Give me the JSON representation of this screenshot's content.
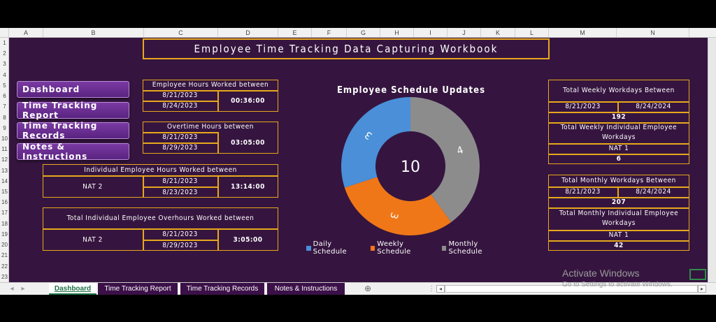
{
  "sheet": {
    "columns": [
      "A",
      "B",
      "C",
      "D",
      "E",
      "F",
      "G",
      "H",
      "I",
      "J",
      "K",
      "L",
      "M",
      "N"
    ],
    "rows": [
      "1",
      "2",
      "3",
      "4",
      "5",
      "6",
      "7",
      "8",
      "9",
      "10",
      "11",
      "12",
      "13",
      "14",
      "15",
      "16",
      "17",
      "18",
      "19",
      "20",
      "21",
      "22",
      "23"
    ]
  },
  "title": "Employee Time Tracking Data Capturing Workbook",
  "nav": {
    "dashboard": "Dashboard",
    "time_tracking_report": "Time Tracking Report",
    "time_tracking_records": "Time Tracking Records",
    "notes": "Notes & Instructions"
  },
  "box1": {
    "header": "Employee Hours Worked between",
    "start": "8/21/2023",
    "end": "8/24/2023",
    "value": "00:36:00"
  },
  "box2": {
    "header": "Overtime Hours between",
    "start": "8/21/2023",
    "end": "8/29/2023",
    "value": "03:05:00"
  },
  "box3": {
    "header": "Individual Employee Hours Worked between",
    "employee": "NAT 2",
    "start": "8/21/2023",
    "end": "8/23/2023",
    "value": "13:14:00"
  },
  "box4": {
    "header": "Total Individual Employee Overhours Worked between",
    "employee": "NAT 2",
    "start": "8/21/2023",
    "end": "8/29/2023",
    "value": "3:05:00"
  },
  "weekly": {
    "header": "Total Weekly Workdays Between",
    "start": "8/21/2023",
    "end": "8/24/2024",
    "value": "192",
    "ind_header": "Total Weekly Individual Employee Workdays",
    "employee": "NAT 1",
    "ind_value": "6"
  },
  "monthly": {
    "header": "Total Monthly Workdays Between",
    "start": "8/21/2023",
    "end": "8/24/2024",
    "value": "207",
    "ind_header": "Total Monthly  Individual Employee Workdays",
    "employee": "NAT 1",
    "ind_value": "42"
  },
  "chart_data": {
    "type": "pie",
    "title": "Employee Schedule Updates",
    "center_label": "10",
    "categories": [
      "Daily Schedule",
      "Weekly Schedule",
      "Monthly Schedule"
    ],
    "values": [
      3,
      3,
      4
    ],
    "colors": [
      "#4a8fd8",
      "#f07718",
      "#8c8c8c"
    ],
    "legend": "bottom"
  },
  "tabs": [
    "Dashboard",
    "Time Tracking Report",
    "Time Tracking Records",
    "Notes & Instructions"
  ],
  "watermark": {
    "line1": "Activate Windows",
    "line2": "Go to Settings to activate Windows."
  }
}
